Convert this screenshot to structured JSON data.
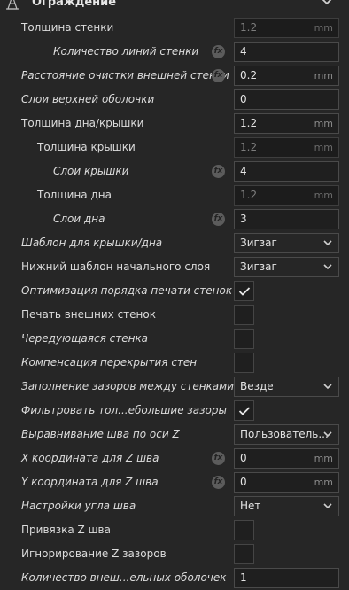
{
  "section": {
    "title": "Ограждение",
    "icon": "wall-icon",
    "expand_icon": "chevron-down-icon"
  },
  "rows": [
    {
      "label": "Толщина стенки",
      "italic": false,
      "indent": 0,
      "fx": false,
      "control": "field",
      "value": "1.2",
      "unit": "mm",
      "disabled": true
    },
    {
      "label": "Количество линий стенки",
      "italic": true,
      "indent": 2,
      "fx": true,
      "control": "field",
      "value": "4",
      "unit": "",
      "disabled": false
    },
    {
      "label": "Расстояние очистки внешней стенки",
      "italic": true,
      "indent": 0,
      "fx": true,
      "control": "field",
      "value": "0.2",
      "unit": "mm",
      "disabled": false
    },
    {
      "label": "Слои верхней оболочки",
      "italic": true,
      "indent": 0,
      "fx": false,
      "control": "field",
      "value": "0",
      "unit": "",
      "disabled": false
    },
    {
      "label": "Толщина дна/крышки",
      "italic": false,
      "indent": 0,
      "fx": false,
      "control": "field",
      "value": "1.2",
      "unit": "mm",
      "disabled": false
    },
    {
      "label": "Толщина крышки",
      "italic": false,
      "indent": 1,
      "fx": false,
      "control": "field",
      "value": "1.2",
      "unit": "mm",
      "disabled": true
    },
    {
      "label": "Слои крышки",
      "italic": true,
      "indent": 2,
      "fx": true,
      "control": "field",
      "value": "4",
      "unit": "",
      "disabled": false
    },
    {
      "label": "Толщина дна",
      "italic": false,
      "indent": 1,
      "fx": false,
      "control": "field",
      "value": "1.2",
      "unit": "mm",
      "disabled": true
    },
    {
      "label": "Слои дна",
      "italic": true,
      "indent": 2,
      "fx": true,
      "control": "field",
      "value": "3",
      "unit": "",
      "disabled": false
    },
    {
      "label": "Шаблон для крышки/дна",
      "italic": true,
      "indent": 0,
      "fx": false,
      "control": "dropdown",
      "value": "Зигзаг"
    },
    {
      "label": "Нижний шаблон начального слоя",
      "italic": false,
      "indent": 0,
      "fx": false,
      "control": "dropdown",
      "value": "Зигзаг"
    },
    {
      "label": "Оптимизация порядка печати стенок",
      "italic": true,
      "indent": 0,
      "fx": false,
      "control": "checkbox",
      "checked": true
    },
    {
      "label": "Печать внешних стенок",
      "italic": false,
      "indent": 0,
      "fx": false,
      "control": "checkbox",
      "checked": false
    },
    {
      "label": "Чередующаяся стенка",
      "italic": true,
      "indent": 0,
      "fx": false,
      "control": "checkbox",
      "checked": false
    },
    {
      "label": "Компенсация перекрытия стен",
      "italic": true,
      "indent": 0,
      "fx": false,
      "control": "checkbox",
      "checked": false
    },
    {
      "label": "Заполнение зазоров между стенками",
      "italic": true,
      "indent": 0,
      "fx": false,
      "control": "dropdown",
      "value": "Везде"
    },
    {
      "label": "Фильтровать тол...ебольшие зазоры",
      "italic": true,
      "indent": 0,
      "fx": false,
      "control": "checkbox",
      "checked": true
    },
    {
      "label": "Выравнивание шва по оси Z",
      "italic": true,
      "indent": 0,
      "fx": false,
      "control": "dropdown",
      "value": "Пользователь..."
    },
    {
      "label": "X координата для Z шва",
      "italic": true,
      "indent": 0,
      "fx": true,
      "control": "field",
      "value": "0",
      "unit": "mm",
      "disabled": false
    },
    {
      "label": "Y координата для Z шва",
      "italic": true,
      "indent": 0,
      "fx": true,
      "control": "field",
      "value": "0",
      "unit": "mm",
      "disabled": false
    },
    {
      "label": "Настройки угла шва",
      "italic": true,
      "indent": 0,
      "fx": false,
      "control": "dropdown",
      "value": "Нет"
    },
    {
      "label": "Привязка Z шва",
      "italic": false,
      "indent": 0,
      "fx": false,
      "control": "checkbox",
      "checked": false
    },
    {
      "label": "Игнорирование Z зазоров",
      "italic": false,
      "indent": 0,
      "fx": false,
      "control": "checkbox",
      "checked": false
    },
    {
      "label": "Количество внеш...ельных оболочек",
      "italic": true,
      "indent": 0,
      "fx": false,
      "control": "field",
      "value": "1",
      "unit": "",
      "disabled": false
    }
  ]
}
